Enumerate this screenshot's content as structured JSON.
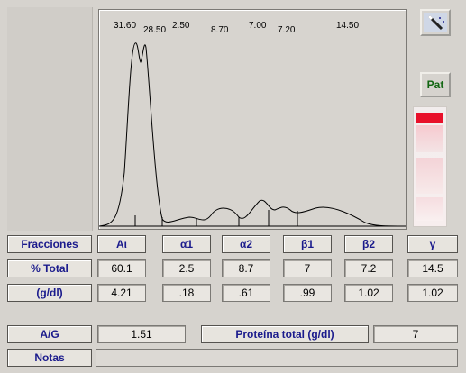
{
  "chart": {
    "peak_labels": [
      "31.60",
      "28.50",
      "2.50",
      "8.70",
      "7.00",
      "7.20",
      "14.50"
    ]
  },
  "buttons": {
    "tool_icon": "magic-wand-icon",
    "pat_label": "Pat"
  },
  "table": {
    "header_label": "Fracciones",
    "fractions": [
      "Aι",
      "α1",
      "α2",
      "β1",
      "β2",
      "γ"
    ],
    "percent_label": "% Total",
    "percent_values": [
      "60.1",
      "2.5",
      "8.7",
      "7",
      "7.2",
      "14.5"
    ],
    "gdl_label": "(g/dl)",
    "gdl_values": [
      "4.21",
      ".18",
      ".61",
      ".99",
      "1.02",
      "1.02"
    ]
  },
  "summary": {
    "ag_label": "A/G",
    "ag_value": "1.51",
    "protein_label": "Proteína total (g/dl)",
    "protein_value": "7",
    "notes_label": "Notas",
    "notes_value": ""
  },
  "colors": {
    "header_text": "#1a1a8c",
    "pat_text": "#116611",
    "gel_band": "#e8102a"
  }
}
